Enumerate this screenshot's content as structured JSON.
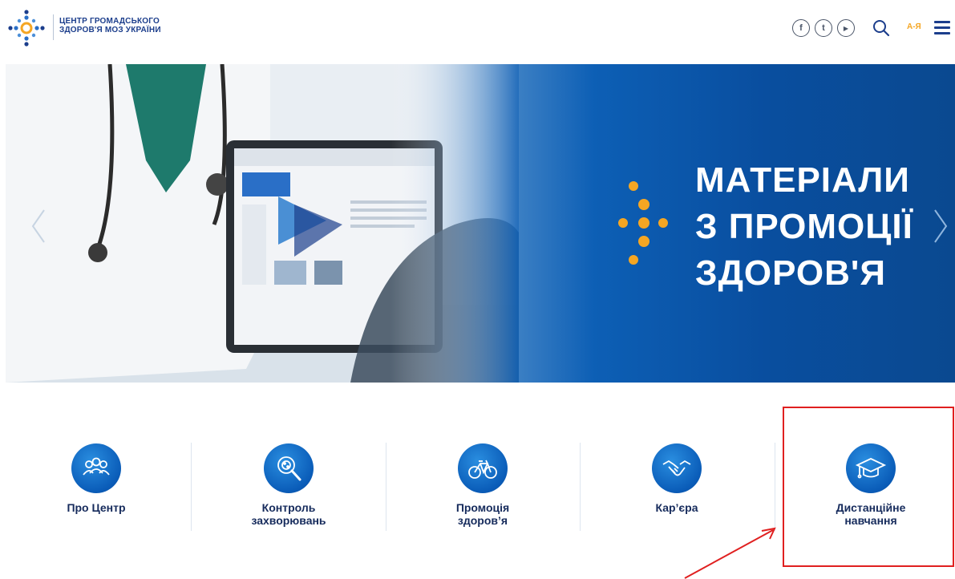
{
  "header": {
    "logo_line1": "ЦЕНТР ГРОМАДСЬКОГО",
    "logo_line2": "ЗДОРОВ'Я МОЗ УКРАЇНИ",
    "social": [
      {
        "icon": "facebook-icon",
        "glyph": "f"
      },
      {
        "icon": "twitter-icon",
        "glyph": "t"
      },
      {
        "icon": "youtube-icon",
        "glyph": "▶"
      }
    ],
    "az_label": "А-Я"
  },
  "banner": {
    "title_line1": "МАТЕРІАЛИ",
    "title_line2": "З ПРОМОЦІЇ",
    "title_line3": "ЗДОРОВ'Я"
  },
  "tiles": [
    {
      "label": "Про Центр",
      "icon": "people-icon"
    },
    {
      "label": "Контроль захворювань",
      "icon": "virus-magnifier-icon"
    },
    {
      "label": "Промоція здоров’я",
      "icon": "bicycle-icon"
    },
    {
      "label": "Кар’єра",
      "icon": "handshake-icon"
    },
    {
      "label": "Дистанційне навчання",
      "icon": "graduation-cap-icon"
    }
  ],
  "colors": {
    "brand_blue": "#0a5cb8",
    "accent_orange": "#f5a623",
    "highlight_red": "#e02020"
  }
}
